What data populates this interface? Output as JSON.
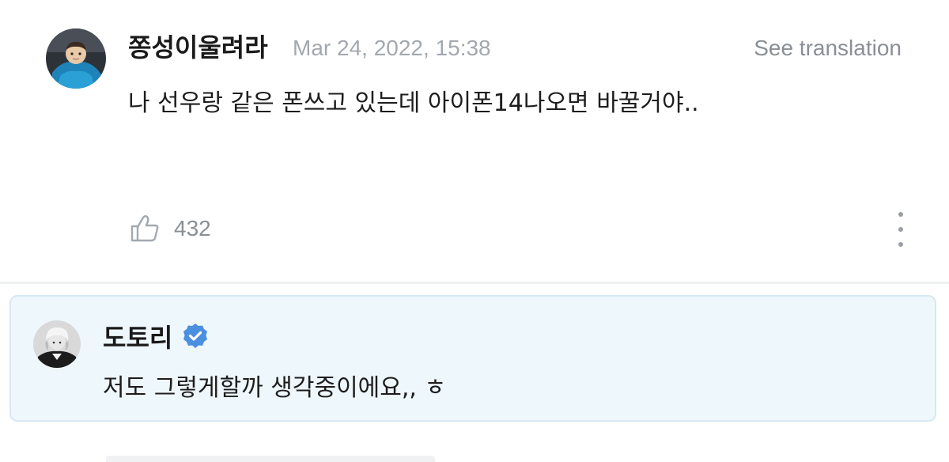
{
  "comment": {
    "author": "쫑성이울려라",
    "timestamp": "Mar 24, 2022, 15:38",
    "see_translation": "See translation",
    "text": "나 선우랑 같은 폰쓰고 있는데 아이폰14나오면 바꿀거야..",
    "likes": "432",
    "avatar_icon": "child-avatar",
    "like_icon": "thumbs-up-icon",
    "more_icon": "vertical-dots-icon"
  },
  "reply": {
    "author": "도토리",
    "verified_icon": "verified-badge-icon",
    "text": "저도 그렇게할까 생각중이에요,, ㅎ",
    "avatar_icon": "artist-avatar"
  },
  "colors": {
    "reply_background": "#eef7fb",
    "reply_border": "#d6e8f1",
    "verified_blue": "#4a8fe0",
    "muted_text": "#a3a8b0"
  }
}
